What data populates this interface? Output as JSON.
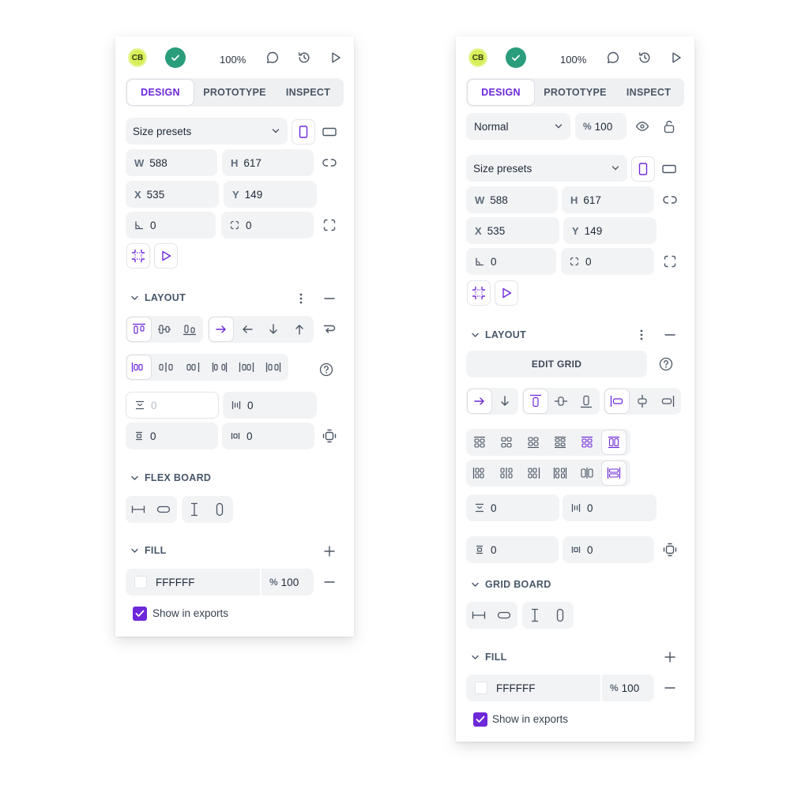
{
  "left_panel": {
    "avatar_initials": "CB",
    "zoom": "100%",
    "tabs": [
      "DESIGN",
      "PROTOTYPE",
      "INSPECT"
    ],
    "size_presets": "Size presets",
    "measures": {
      "w_label": "W",
      "w_value": "588",
      "h_label": "H",
      "h_value": "617",
      "x_label": "X",
      "x_value": "535",
      "y_label": "Y",
      "y_value": "149",
      "rotation": "0",
      "radius": "0"
    },
    "layout": {
      "title": "LAYOUT",
      "row_gap_placeholder": "0",
      "column_gap": "0",
      "padding_vertical": "0",
      "padding_horizontal": "0"
    },
    "board_section": "FLEX BOARD",
    "fill": {
      "title": "FILL",
      "hex": "FFFFFF",
      "opacity_label": "%",
      "opacity": "100",
      "show_in_exports": "Show in exports"
    }
  },
  "right_panel": {
    "avatar_initials": "CB",
    "zoom": "100%",
    "tabs": [
      "DESIGN",
      "PROTOTYPE",
      "INSPECT"
    ],
    "blend_mode": "Normal",
    "layer_opacity_label": "%",
    "layer_opacity": "100",
    "size_presets": "Size presets",
    "measures": {
      "w_label": "W",
      "w_value": "588",
      "h_label": "H",
      "h_value": "617",
      "x_label": "X",
      "x_value": "535",
      "y_label": "Y",
      "y_value": "149",
      "rotation": "0",
      "radius": "0"
    },
    "layout": {
      "title": "LAYOUT",
      "edit_grid": "EDIT GRID",
      "row_gap": "0",
      "column_gap": "0",
      "padding_vertical": "0",
      "padding_horizontal": "0"
    },
    "board_section": "GRID BOARD",
    "fill": {
      "title": "FILL",
      "hex": "FFFFFF",
      "opacity_label": "%",
      "opacity": "100",
      "show_in_exports": "Show in exports"
    }
  },
  "colors": {
    "accent": "#6d28d9",
    "success": "#2a9d7c",
    "avatar": "#d9ef5a",
    "field_bg": "#f2f3f5"
  }
}
